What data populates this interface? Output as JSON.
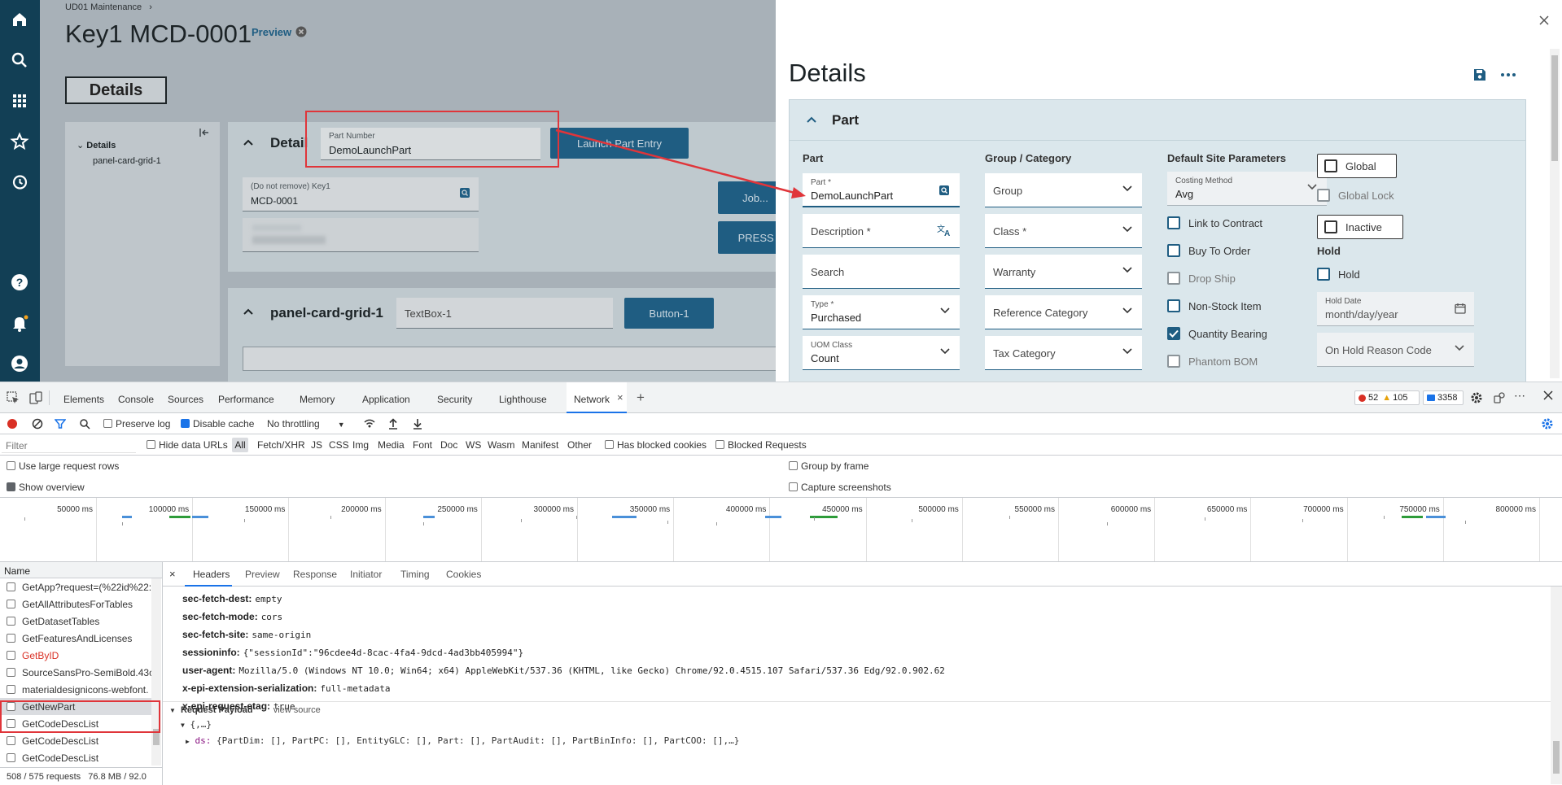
{
  "app": {
    "breadcrumb": "UD01 Maintenance",
    "breadcrumb_sep": "›",
    "title": "Key1 MCD-0001",
    "preview": "Preview",
    "details_tab": "Details",
    "tree": {
      "root": "Details",
      "child": "panel-card-grid-1"
    },
    "details_card": {
      "title": "Detail",
      "part_number_label": "Part Number",
      "part_number_value": "DemoLaunchPart",
      "launch_button": "Launch Part Entry",
      "key1_label": "(Do not remove) Key1",
      "key1_value": "MCD-0001",
      "job_button": "Job...",
      "press_button": "PRESS ME!"
    },
    "grid_card": {
      "title": "panel-card-grid-1",
      "textbox": "TextBox-1",
      "button": "Button-1"
    }
  },
  "panel": {
    "title": "Details",
    "section": "Part",
    "col_part": {
      "heading": "Part",
      "part_label": "Part *",
      "part_value": "DemoLaunchPart",
      "description": "Description *",
      "search": "Search",
      "type_label": "Type *",
      "type_value": "Purchased",
      "uom_label": "UOM Class",
      "uom_value": "Count"
    },
    "col_group": {
      "heading": "Group / Category",
      "group": "Group",
      "class": "Class *",
      "warranty": "Warranty",
      "reference": "Reference Category",
      "tax": "Tax Category"
    },
    "col_site": {
      "heading": "Default Site Parameters",
      "costing_label": "Costing Method",
      "costing_value": "Avg",
      "link_contract": "Link to Contract",
      "buy_to_order": "Buy To Order",
      "drop_ship": "Drop Ship",
      "non_stock": "Non-Stock Item",
      "qty_bearing": "Quantity Bearing",
      "phantom_bom": "Phantom BOM"
    },
    "col_flags": {
      "global": "Global",
      "global_lock": "Global Lock",
      "inactive": "Inactive",
      "hold_heading": "Hold",
      "hold": "Hold",
      "hold_date_label": "Hold Date",
      "hold_date_placeholder": "month/day/year",
      "on_hold_reason": "On Hold Reason Code"
    }
  },
  "devtools": {
    "tabs": [
      "Elements",
      "Console",
      "Sources",
      "Performance",
      "Memory",
      "Application",
      "Security",
      "Lighthouse",
      "Network"
    ],
    "active_tab": "Network",
    "tab_close": "×",
    "add_tab": "+",
    "errors": "52",
    "warnings": "105",
    "messages": "3358",
    "toolbar": {
      "preserve_log": "Preserve log",
      "disable_cache": "Disable cache",
      "throttling": "No throttling"
    },
    "filter": {
      "placeholder": "Filter",
      "hide_data_urls": "Hide data URLs",
      "types": [
        "All",
        "Fetch/XHR",
        "JS",
        "CSS",
        "Img",
        "Media",
        "Font",
        "Doc",
        "WS",
        "Wasm",
        "Manifest",
        "Other"
      ],
      "blocked_cookies": "Has blocked cookies",
      "blocked_requests": "Blocked Requests"
    },
    "options": {
      "large_rows": "Use large request rows",
      "show_overview": "Show overview",
      "group_by_frame": "Group by frame",
      "capture_screenshots": "Capture screenshots"
    },
    "ruler": [
      "50000 ms",
      "100000 ms",
      "150000 ms",
      "200000 ms",
      "250000 ms",
      "300000 ms",
      "350000 ms",
      "400000 ms",
      "450000 ms",
      "500000 ms",
      "550000 ms",
      "600000 ms",
      "650000 ms",
      "700000 ms",
      "750000 ms",
      "800000 ms"
    ],
    "name_header": "Name",
    "requests": [
      {
        "name": "GetApp?request=(%22id%22:",
        "error": false
      },
      {
        "name": "GetAllAttributesForTables",
        "error": false
      },
      {
        "name": "GetDatasetTables",
        "error": false
      },
      {
        "name": "GetFeaturesAndLicenses",
        "error": false
      },
      {
        "name": "GetByID",
        "error": true
      },
      {
        "name": "SourceSansPro-SemiBold.43c",
        "error": false
      },
      {
        "name": "materialdesignicons-webfont.",
        "error": false
      },
      {
        "name": "GetNewPart",
        "error": false
      },
      {
        "name": "GetCodeDescList",
        "error": false
      },
      {
        "name": "GetCodeDescList",
        "error": false
      },
      {
        "name": "GetCodeDescList",
        "error": false
      }
    ],
    "status_bar": "508 / 575 requests   76.8 MB / 92.0",
    "detail_tabs": [
      "Headers",
      "Preview",
      "Response",
      "Initiator",
      "Timing",
      "Cookies"
    ],
    "close": "×",
    "headers": [
      {
        "key": "sec-fetch-dest:",
        "value": "empty"
      },
      {
        "key": "sec-fetch-mode:",
        "value": "cors"
      },
      {
        "key": "sec-fetch-site:",
        "value": "same-origin"
      },
      {
        "key": "sessioninfo:",
        "value": "{\"sessionId\":\"96cdee4d-8cac-4fa4-9dcd-4ad3bb405994\"}"
      },
      {
        "key": "user-agent:",
        "value": "Mozilla/5.0 (Windows NT 10.0; Win64; x64) AppleWebKit/537.36 (KHTML, like Gecko) Chrome/92.0.4515.107 Safari/537.36 Edg/92.0.902.62"
      },
      {
        "key": "x-epi-extension-serialization:",
        "value": "full-metadata"
      },
      {
        "key": "x-epi-request-etag:",
        "value": "true"
      }
    ],
    "payload": {
      "title": "Request Payload",
      "view_source": "view source",
      "root": "{,…}",
      "ds_key": "ds:",
      "ds_value": "{PartDim: [], PartPC: [], EntityGLC: [], Part: [], PartAudit: [], PartBinInfo: [], PartCOO: [],…}"
    }
  },
  "colors": {
    "nav": "#123f55",
    "accent": "#1f5d82",
    "annotation": "#e0353a",
    "panel_card": "#dbe7ec",
    "error_text": "#d93025"
  }
}
